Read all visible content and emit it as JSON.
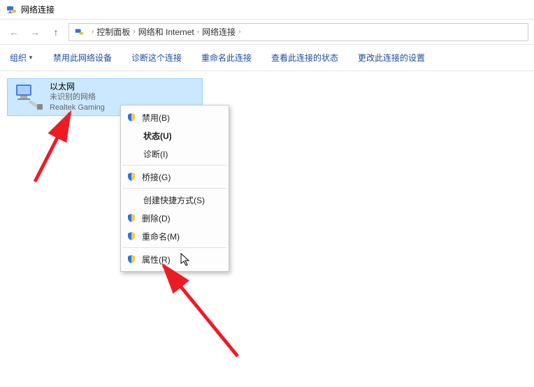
{
  "window": {
    "title": "网络连接"
  },
  "breadcrumb": {
    "item1": "控制面板",
    "item2": "网络和 Internet",
    "item3": "网络连接"
  },
  "toolbar": {
    "organize": "组织",
    "disable": "禁用此网络设备",
    "diagnose": "诊断这个连接",
    "rename": "重命名此连接",
    "status": "查看此连接的状态",
    "settings": "更改此连接的设置"
  },
  "adapter": {
    "name": "以太网",
    "status": "未识别的网络",
    "device": "Realtek Gaming"
  },
  "menu": {
    "disable": "禁用(B)",
    "status": "状态(U)",
    "diagnose": "诊断(I)",
    "bridge": "桥接(G)",
    "shortcut": "创建快捷方式(S)",
    "delete": "删除(D)",
    "rename": "重命名(M)",
    "properties": "属性(R)"
  }
}
